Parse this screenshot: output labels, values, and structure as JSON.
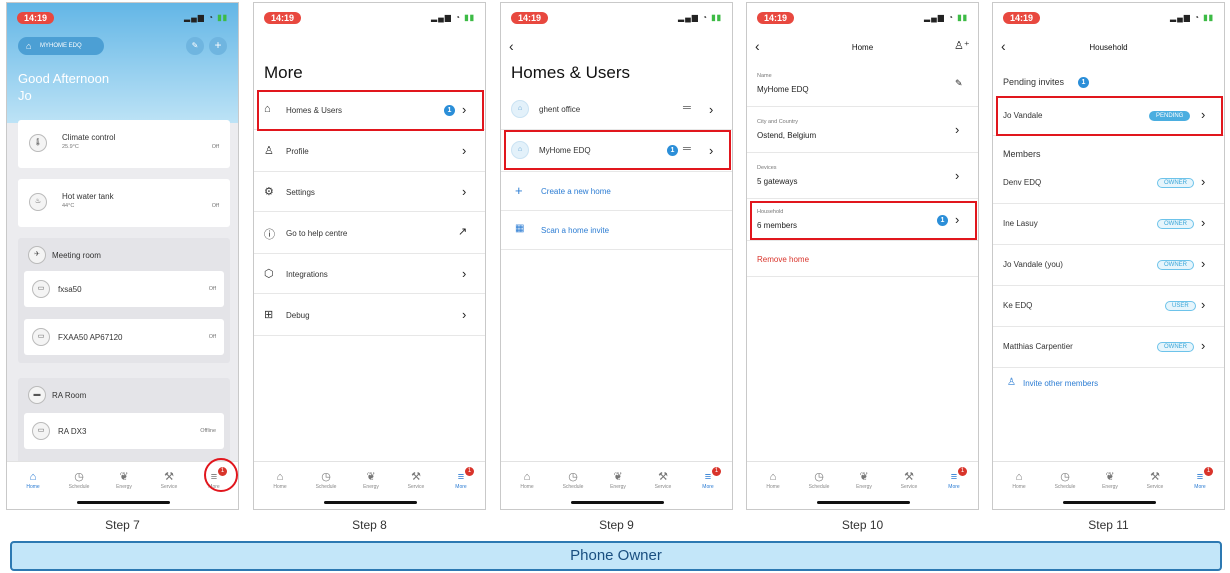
{
  "status_time": "14:19",
  "steps": [
    "Step 7",
    "Step 8",
    "Step 9",
    "Step 10",
    "Step 11"
  ],
  "owner_label": "Phone Owner",
  "tabs": {
    "home": "Home",
    "schedule": "Schedule",
    "energy": "Energy",
    "service": "Service",
    "more": "More",
    "more_badge": "1"
  },
  "p1": {
    "home_name": "MYHOME EDQ",
    "greeting": "Good Afternoon",
    "user": "Jo",
    "climate": {
      "name": "Climate control",
      "temp": "25.9°C",
      "state": "Off"
    },
    "hotwater": {
      "name": "Hot water tank",
      "temp": "44°C",
      "state": "Off"
    },
    "meeting": {
      "title": "Meeting room",
      "d1": "fxsa50",
      "d1s": "Off",
      "d2": "FXAA50 AP67120",
      "d2s": "Off"
    },
    "ra": {
      "title": "RA Room",
      "d1": "RA DX3",
      "d1s": "Offline"
    }
  },
  "p2": {
    "title": "More",
    "items": [
      "Homes & Users",
      "Profile",
      "Settings",
      "Go to help centre",
      "Integrations",
      "Debug"
    ],
    "badge": "1"
  },
  "p3": {
    "title": "Homes & Users",
    "h1": "ghent office",
    "h2": "MyHome EDQ",
    "badge": "1",
    "create": "Create a new home",
    "scan": "Scan a home invite"
  },
  "p4": {
    "title": "Home",
    "name_lbl": "Name",
    "name_val": "MyHome EDQ",
    "city_lbl": "City and Country",
    "city_val": "Ostend, Belgium",
    "dev_lbl": "Devices",
    "dev_val": "5 gateways",
    "hh_lbl": "Household",
    "hh_val": "6 members",
    "badge": "1",
    "remove": "Remove home"
  },
  "p5": {
    "title": "Household",
    "pending_title": "Pending invites",
    "pending_badge": "1",
    "pending_name": "Jo Vandale",
    "pending_pill": "PENDING",
    "members_title": "Members",
    "members": [
      {
        "name": "Denv EDQ",
        "role": "OWNER"
      },
      {
        "name": "Ine Lasuy",
        "role": "OWNER"
      },
      {
        "name": "Jo Vandale (you)",
        "role": "OWNER"
      },
      {
        "name": "Ke EDQ",
        "role": "USER"
      },
      {
        "name": "Matthias Carpentier",
        "role": "OWNER"
      }
    ],
    "invite": "Invite other members"
  },
  "colors": {
    "accent": "#2b7cd3",
    "highlight": "#e1161d",
    "badge": "#2b8ed8",
    "remove": "#d9342b"
  }
}
